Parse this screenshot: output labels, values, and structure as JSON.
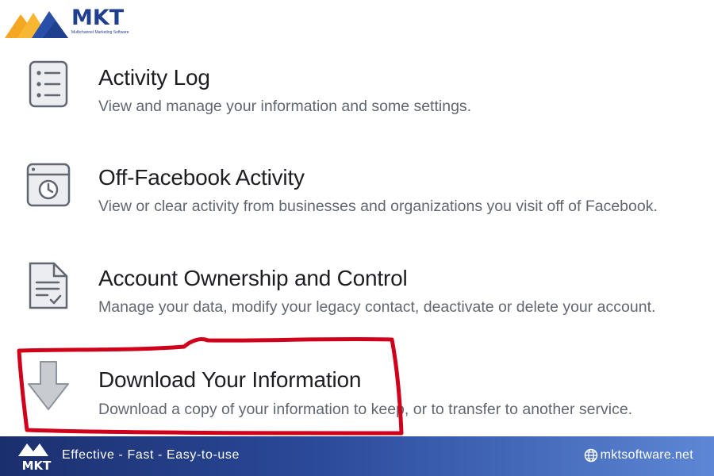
{
  "brand": {
    "name": "MKT",
    "tagline": "Multichannel Marketing Software"
  },
  "menu": {
    "items": [
      {
        "icon": "activity-log-icon",
        "title": "Activity Log",
        "description": "View and manage your information and some settings."
      },
      {
        "icon": "off-facebook-activity-icon",
        "title": "Off-Facebook Activity",
        "description": "View or clear activity from businesses and organizations you visit off of Facebook."
      },
      {
        "icon": "account-ownership-icon",
        "title": "Account Ownership and Control",
        "description": "Manage your data, modify your legacy contact, deactivate or delete your account."
      },
      {
        "icon": "download-arrow-icon",
        "title": "Download Your Information",
        "description": "Download a copy of your information to keep, or to transfer to another service.",
        "highlighted": true
      }
    ]
  },
  "banner": {
    "slogan": "Effective - Fast - Easy-to-use",
    "website": "mktsoftware.net"
  },
  "colors": {
    "highlight": "#d0021b",
    "brand_blue": "#1f3f8f",
    "brand_orange": "#f5a623",
    "icon_gray": "#8d949e"
  }
}
